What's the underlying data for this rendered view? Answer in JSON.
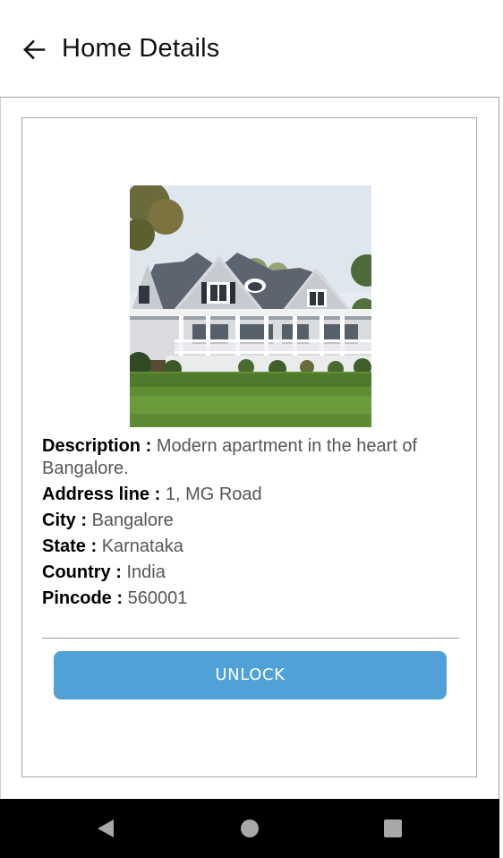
{
  "header": {
    "title": "Home Details",
    "back_icon": "arrow-left-icon"
  },
  "details": {
    "image": "house-photo",
    "description_label": "Description :",
    "description_value": "Modern apartment in the heart of Bangalore.",
    "address_label": "Address line :",
    "address_value": "1, MG Road",
    "city_label": "City :",
    "city_value": "Bangalore",
    "state_label": "State :",
    "state_value": "Karnataka",
    "country_label": "Country :",
    "country_value": "India",
    "pincode_label": "Pincode :",
    "pincode_value": "560001"
  },
  "actions": {
    "unlock_label": "UNLOCK"
  },
  "nav": {
    "back": "triangle-back-icon",
    "home": "circle-home-icon",
    "recents": "square-recents-icon"
  },
  "colors": {
    "button": "#4fa1d8",
    "label": "#000000",
    "value": "#555555"
  }
}
